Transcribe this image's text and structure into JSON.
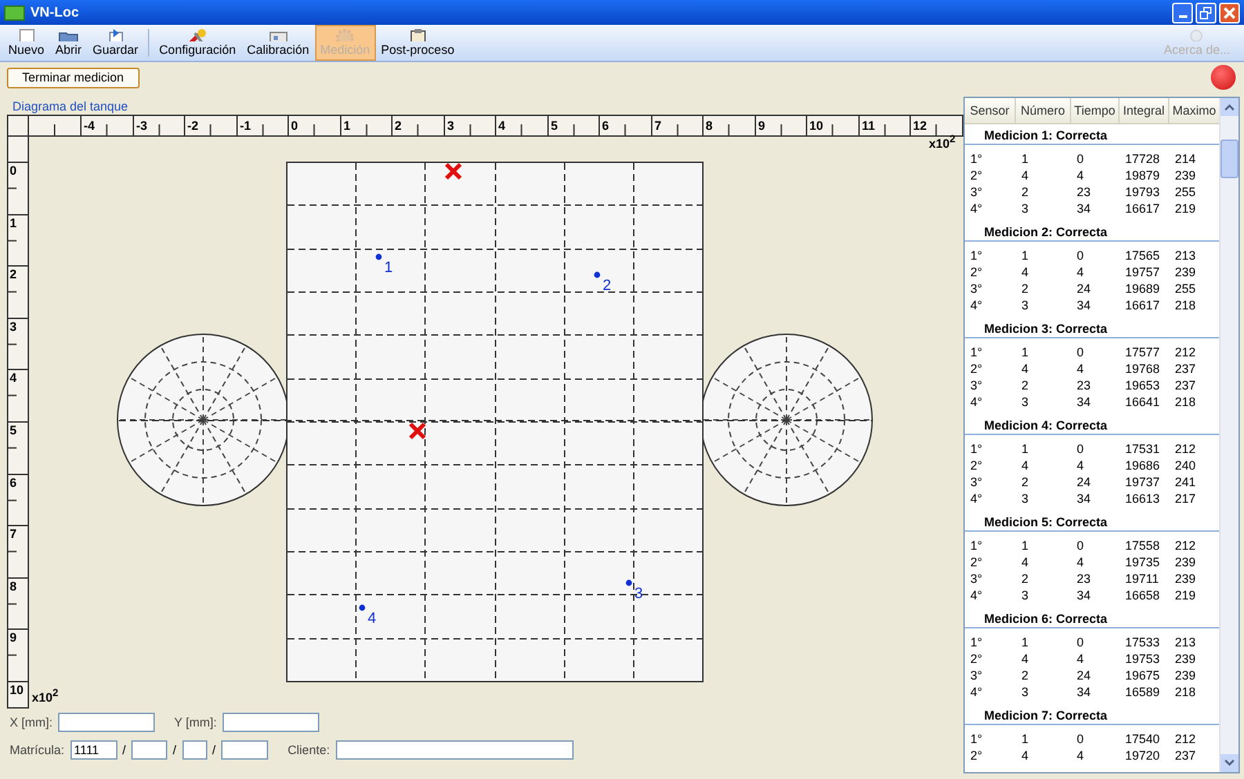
{
  "window": {
    "title": "VN-Loc"
  },
  "toolbar": [
    {
      "kind": "page",
      "label": "Nuevo",
      "selected": false,
      "disabled": false
    },
    {
      "kind": "folder",
      "label": "Abrir",
      "selected": false,
      "disabled": false
    },
    {
      "kind": "disk",
      "label": "Guardar",
      "selected": false,
      "disabled": false
    },
    {
      "kind": "separator"
    },
    {
      "kind": "tools",
      "label": "Configuración",
      "selected": false,
      "disabled": false
    },
    {
      "kind": "screen",
      "label": "Calibración",
      "selected": false,
      "disabled": false
    },
    {
      "kind": "gear",
      "label": "Medición",
      "selected": true,
      "disabled": true
    },
    {
      "kind": "clipboard",
      "label": "Post-proceso",
      "selected": false,
      "disabled": false
    },
    {
      "kind": "bulb",
      "label": "Acerca de...",
      "selected": false,
      "disabled": true
    }
  ],
  "action_button": "Terminar medicion",
  "diagram": {
    "title": "Diagrama del tanque",
    "x_labels": [
      "-4",
      "-3",
      "-2",
      "-1",
      "0",
      "1",
      "2",
      "3",
      "4",
      "5",
      "6",
      "7",
      "8",
      "9",
      "10",
      "11",
      "12"
    ],
    "y_labels": [
      "0",
      "1",
      "2",
      "3",
      "4",
      "5",
      "6",
      "7",
      "8",
      "9",
      "10"
    ],
    "x_scale": "x10$^{2}$",
    "y_scale": "x10$^{2}$",
    "markers": [
      {
        "kind": "cross"
      },
      {
        "kind": "sensor",
        "label": "1"
      },
      {
        "kind": "sensor",
        "label": "2"
      },
      {
        "kind": "cross"
      },
      {
        "kind": "sensor",
        "label": "3"
      },
      {
        "kind": "sensor",
        "label": "4"
      }
    ]
  },
  "form": {
    "x_label": "X [mm]:",
    "y_label": "Y [mm]:",
    "matricula_label": "Matrícula:",
    "matricula": "1111",
    "separators": [
      "/",
      "/",
      "/"
    ],
    "cliente_label": "Cliente:"
  },
  "results": {
    "columns": [
      "Sensor",
      "Número",
      "Tiempo",
      "Integral",
      "Maximo"
    ],
    "groups": [
      {
        "title": "Medicion 1: Correcta",
        "rows": [
          [
            "1°",
            "1",
            "0",
            "17728",
            "214"
          ],
          [
            "2°",
            "4",
            "4",
            "19879",
            "239"
          ],
          [
            "3°",
            "2",
            "23",
            "19793",
            "255"
          ],
          [
            "4°",
            "3",
            "34",
            "16617",
            "219"
          ]
        ]
      },
      {
        "title": "Medicion 2: Correcta",
        "rows": [
          [
            "1°",
            "1",
            "0",
            "17565",
            "213"
          ],
          [
            "2°",
            "4",
            "4",
            "19757",
            "239"
          ],
          [
            "3°",
            "2",
            "24",
            "19689",
            "255"
          ],
          [
            "4°",
            "3",
            "34",
            "16617",
            "218"
          ]
        ]
      },
      {
        "title": "Medicion 3: Correcta",
        "rows": [
          [
            "1°",
            "1",
            "0",
            "17577",
            "212"
          ],
          [
            "2°",
            "4",
            "4",
            "19768",
            "237"
          ],
          [
            "3°",
            "2",
            "23",
            "19653",
            "237"
          ],
          [
            "4°",
            "3",
            "34",
            "16641",
            "218"
          ]
        ]
      },
      {
        "title": "Medicion 4: Correcta",
        "rows": [
          [
            "1°",
            "1",
            "0",
            "17531",
            "212"
          ],
          [
            "2°",
            "4",
            "4",
            "19686",
            "240"
          ],
          [
            "3°",
            "2",
            "24",
            "19737",
            "241"
          ],
          [
            "4°",
            "3",
            "34",
            "16613",
            "217"
          ]
        ]
      },
      {
        "title": "Medicion 5: Correcta",
        "rows": [
          [
            "1°",
            "1",
            "0",
            "17558",
            "212"
          ],
          [
            "2°",
            "4",
            "4",
            "19735",
            "239"
          ],
          [
            "3°",
            "2",
            "23",
            "19711",
            "239"
          ],
          [
            "4°",
            "3",
            "34",
            "16658",
            "219"
          ]
        ]
      },
      {
        "title": "Medicion 6: Correcta",
        "rows": [
          [
            "1°",
            "1",
            "0",
            "17533",
            "213"
          ],
          [
            "2°",
            "4",
            "4",
            "19753",
            "239"
          ],
          [
            "3°",
            "2",
            "24",
            "19675",
            "239"
          ],
          [
            "4°",
            "3",
            "34",
            "16589",
            "218"
          ]
        ]
      },
      {
        "title": "Medicion 7: Correcta",
        "rows": [
          [
            "1°",
            "1",
            "0",
            "17540",
            "212"
          ],
          [
            "2°",
            "4",
            "4",
            "19720",
            "237"
          ]
        ]
      }
    ]
  }
}
